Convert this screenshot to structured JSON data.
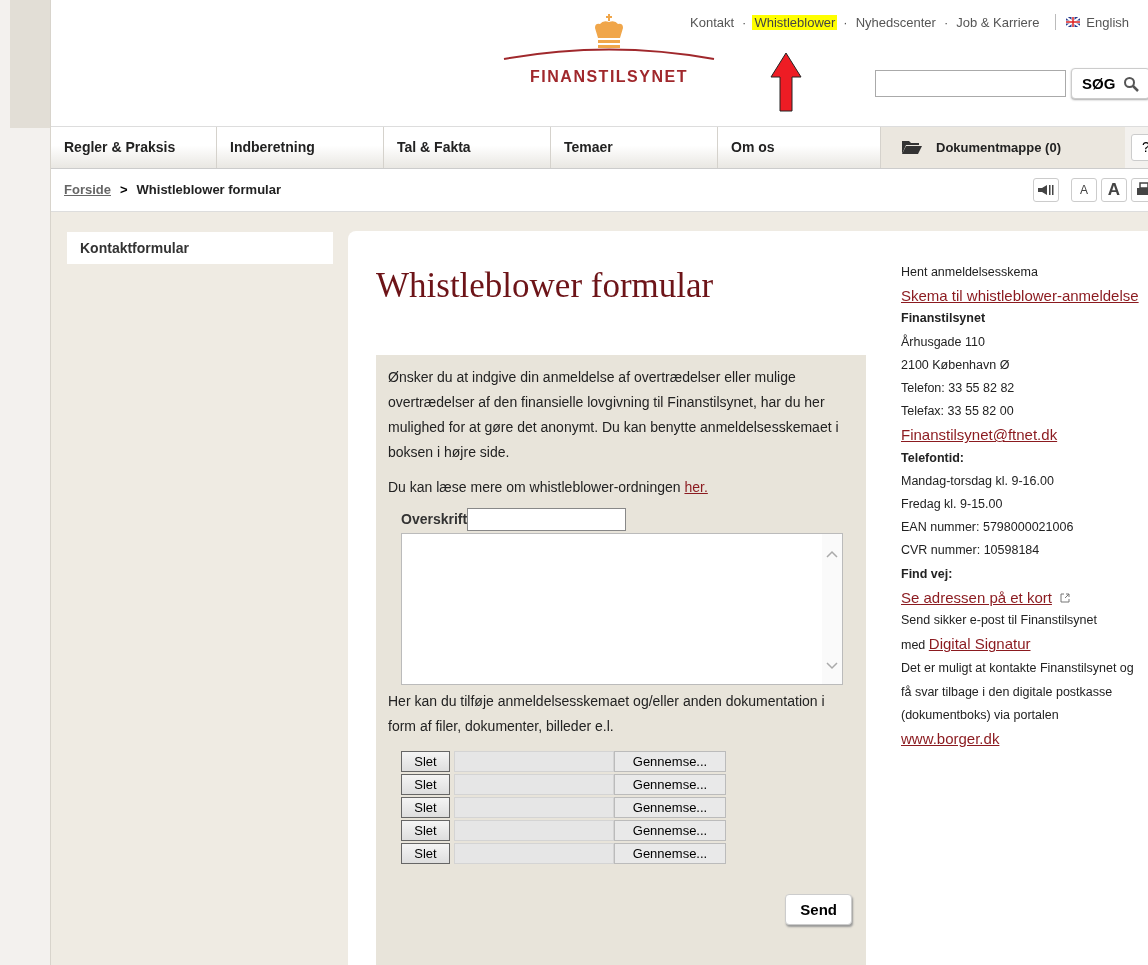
{
  "top_links": [
    {
      "label": "Kontakt",
      "highlighted": false
    },
    {
      "label": "Whistleblower",
      "highlighted": true
    },
    {
      "label": "Nyhedscenter",
      "highlighted": false
    },
    {
      "label": "Job & Karriere",
      "highlighted": false
    }
  ],
  "link_separator": "·",
  "language": "English",
  "logo": {
    "name": "FINANSTILSYNET"
  },
  "search": {
    "button": "SØG"
  },
  "nav": [
    {
      "label": "Regler & Praksis",
      "kind": "tab"
    },
    {
      "label": "Indberetning",
      "kind": "tab"
    },
    {
      "label": "Tal & Fakta",
      "kind": "tab"
    },
    {
      "label": "Temaer",
      "kind": "tab"
    },
    {
      "label": "Om os",
      "kind": "tab"
    },
    {
      "label": "Dokumentmappe (0)",
      "kind": "folder"
    }
  ],
  "help_button": "?",
  "breadcrumb": {
    "home": "Forside",
    "separator": ">",
    "current": "Whistleblower formular"
  },
  "text_size_buttons": [
    "A",
    "A"
  ],
  "sidebar": {
    "items": [
      {
        "label": "Kontaktformular",
        "selected": true
      }
    ]
  },
  "page_title": "Whistleblower formular",
  "form": {
    "intro": "Ønsker du at indgive din anmeldelse af overtrædelser eller mulige overtrædelser af den finansielle lovgivning til Finanstilsynet, har du her mulighed for at gøre det anonymt. Du kan benytte anmeldelsesskemaet i boksen i højre side.",
    "more_text": "Du kan læse mere om whistleblower-ordningen ",
    "more_link": "her.",
    "title_label": "Overskrift",
    "attach_text": "Her kan du tilføje anmeldelsesskemaet og/eller anden dokumentation i form af filer, dokumenter, billeder e.l.",
    "files": [
      {
        "delete": "Slet",
        "browse": "Gennemse..."
      },
      {
        "delete": "Slet",
        "browse": "Gennemse..."
      },
      {
        "delete": "Slet",
        "browse": "Gennemse..."
      },
      {
        "delete": "Slet",
        "browse": "Gennemse..."
      },
      {
        "delete": "Slet",
        "browse": "Gennemse..."
      }
    ],
    "submit": "Send"
  },
  "contact": [
    {
      "kind": "text",
      "text": "Hent anmeldelsesskema"
    },
    {
      "kind": "link",
      "text": "Skema til whistleblower-anmeldelse"
    },
    {
      "kind": "bold",
      "text": "Finanstilsynet"
    },
    {
      "kind": "text",
      "text": "Århusgade 110"
    },
    {
      "kind": "text",
      "text": "2100 København Ø"
    },
    {
      "kind": "text",
      "text": "Telefon: 33 55 82 82"
    },
    {
      "kind": "text",
      "text": "Telefax: 33 55 82 00"
    },
    {
      "kind": "link",
      "text": "Finanstilsynet@ftnet.dk"
    },
    {
      "kind": "bold",
      "text": "Telefontid:"
    },
    {
      "kind": "text",
      "text": "Mandag-torsdag kl. 9-16.00"
    },
    {
      "kind": "text",
      "text": "Fredag kl. 9-15.00"
    },
    {
      "kind": "text",
      "text": "EAN nummer: 5798000021006"
    },
    {
      "kind": "text",
      "text": "CVR nummer: 10598184"
    },
    {
      "kind": "bold",
      "text": "Find vej:"
    },
    {
      "kind": "external",
      "text": "Se adressen på et kort"
    },
    {
      "kind": "text",
      "text": "Send sikker e-post til Finanstilsynet"
    },
    {
      "kind": "prefixed",
      "prefix": "med ",
      "text": "Digital Signatur"
    },
    {
      "kind": "text",
      "text": "Det er muligt at kontakte Finanstilsynet og få svar tilbage i den digitale postkasse (dokumentboks) via portalen"
    },
    {
      "kind": "link",
      "text": "www.borger.dk"
    }
  ]
}
